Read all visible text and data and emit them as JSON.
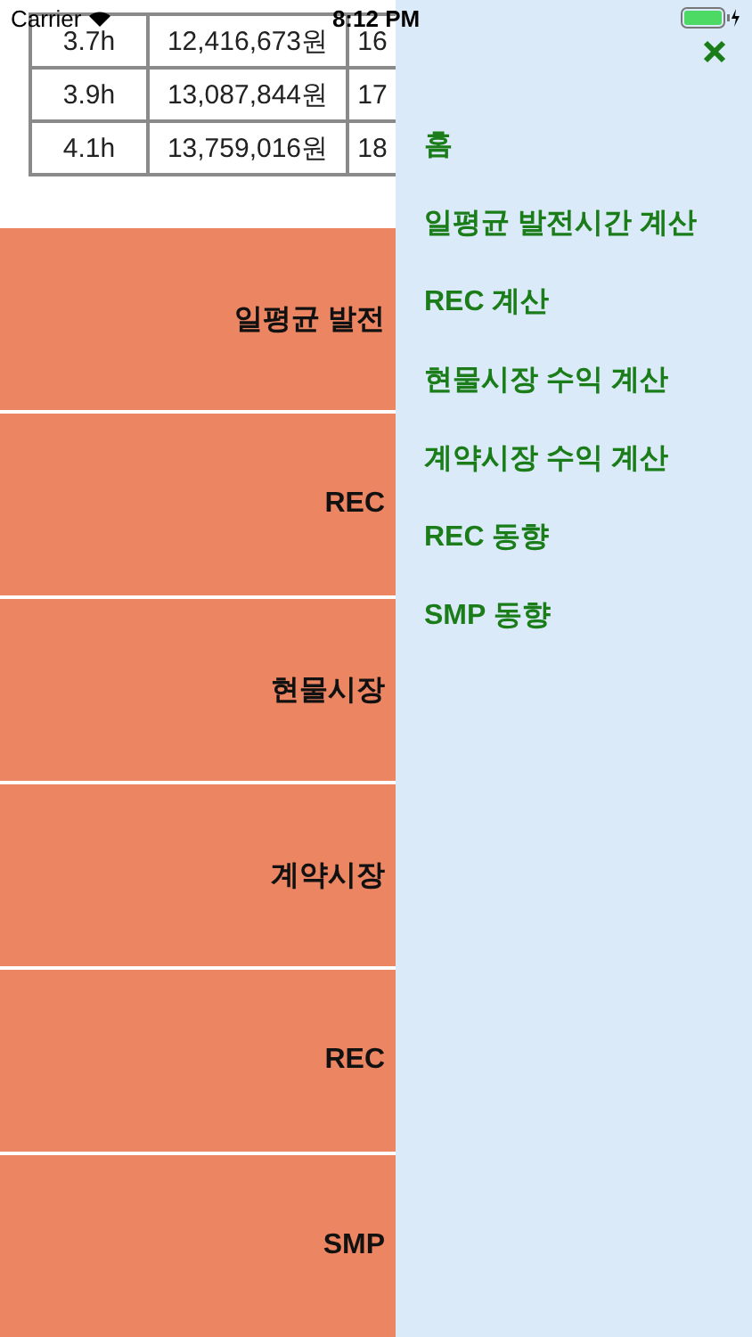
{
  "status_bar": {
    "carrier": "Carrier",
    "time": "8:12 PM"
  },
  "table": {
    "rows": [
      [
        "3.7h",
        "12,416,673원",
        "16"
      ],
      [
        "3.9h",
        "13,087,844원",
        "17"
      ],
      [
        "4.1h",
        "13,759,016원",
        "18"
      ]
    ]
  },
  "buttons": [
    "일평균 발전",
    "REC",
    "현물시장",
    "계약시장",
    "REC",
    "SMP"
  ],
  "drawer": {
    "items": [
      "홈",
      "일평균 발전시간 계산",
      "REC 계산",
      "현물시장 수익 계산",
      "계약시장 수익 계산",
      "REC 동향",
      "SMP 동향"
    ]
  }
}
